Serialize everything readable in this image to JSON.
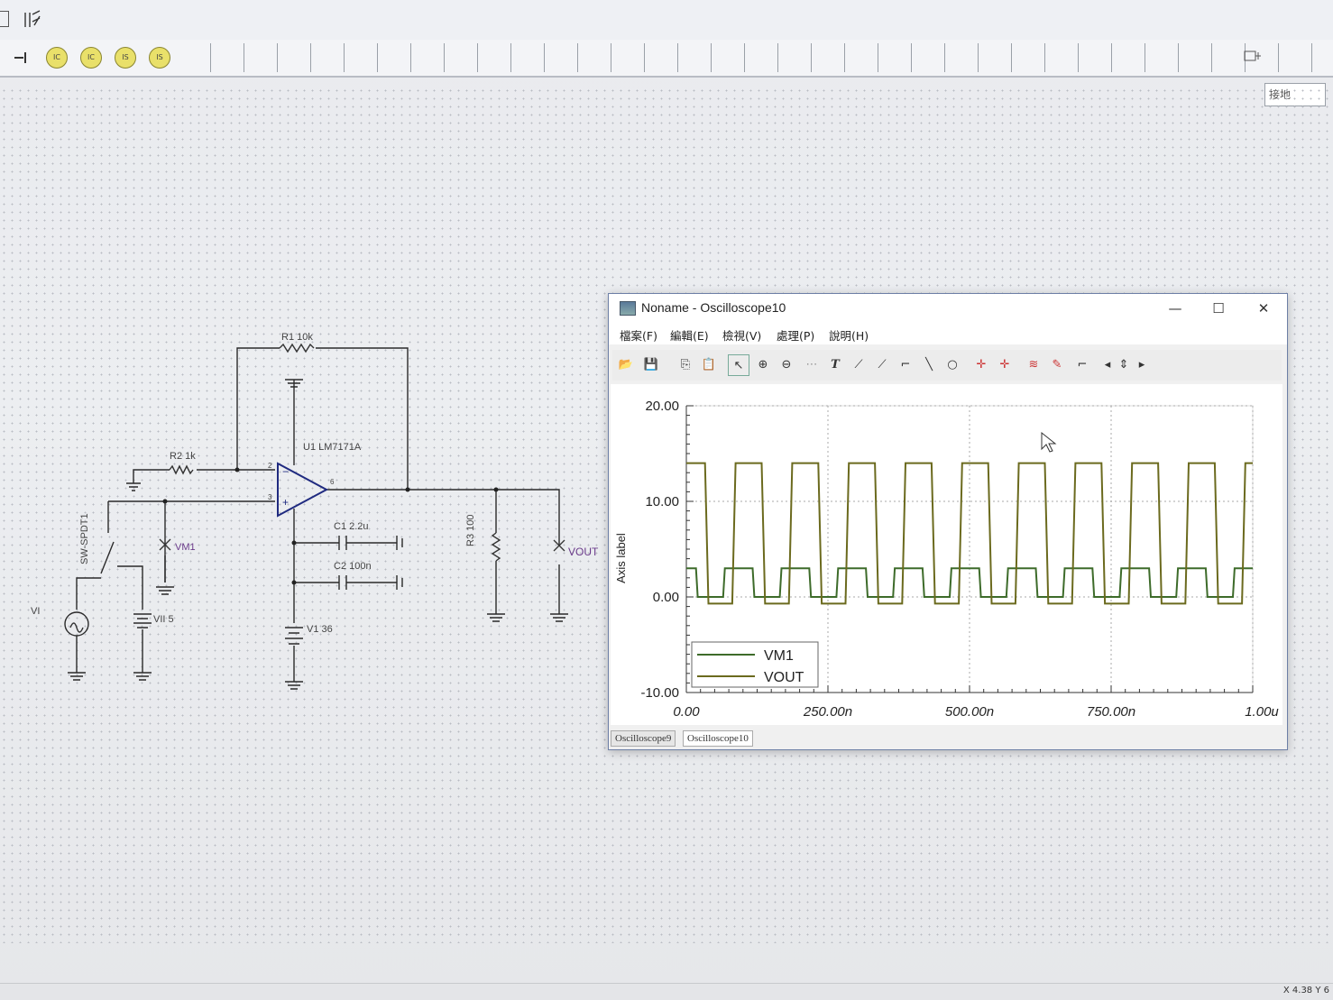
{
  "toolbar": {
    "parts": [
      "IC",
      "IC",
      "IS",
      "IS"
    ],
    "ground_label": "接地"
  },
  "schematic": {
    "r1": "R1 10k",
    "r2": "R2 1k",
    "r3": "R3 100",
    "u1": "U1 LM7171A",
    "c1": "C1 2.2u",
    "c2": "C2 100n",
    "v1": "V1 36",
    "vi": "VI",
    "vii": "VII 5",
    "sw": "SW-SPDT1",
    "vm1": "VM1",
    "vout": "VOUT",
    "pin2": "2",
    "pin3": "3",
    "pin6": "6"
  },
  "scope": {
    "title": "Noname - Oscilloscope10",
    "menu": [
      "檔案(F)",
      "編輯(E)",
      "檢視(V)",
      "處理(P)",
      "說明(H)"
    ],
    "minimize": "—",
    "maximize": "☐",
    "close": "✕",
    "tabs": [
      "Oscilloscope9",
      "Oscilloscope10"
    ],
    "active_tab": "Oscilloscope10"
  },
  "chart_data": {
    "type": "line",
    "ylabel": "Axis label",
    "xlabel": "",
    "y_ticks": [
      "20.00",
      "10.00",
      "0.00",
      "-10.00"
    ],
    "x_ticks": [
      "0.00",
      "250.00n",
      "500.00n",
      "750.00n",
      "1.00u"
    ],
    "ylim": [
      -10,
      20
    ],
    "xlim": [
      0,
      1e-06
    ],
    "legend_position": "bottom-left",
    "series": [
      {
        "name": "VM1",
        "color": "#3d6b2a",
        "high": 3.0,
        "low": 0.0,
        "period": 1e-07,
        "duty": 0.52,
        "rise": 3e-09,
        "first_high_end": 1.7e-08
      },
      {
        "name": "VOUT",
        "color": "#6b6a1e",
        "high": 14.0,
        "low": -0.7,
        "period": 1e-07,
        "duty": 0.52,
        "rise": 6e-09,
        "first_high_end": 3.3e-08
      }
    ]
  },
  "status": {
    "coords": "X 4.38  Y 6"
  }
}
